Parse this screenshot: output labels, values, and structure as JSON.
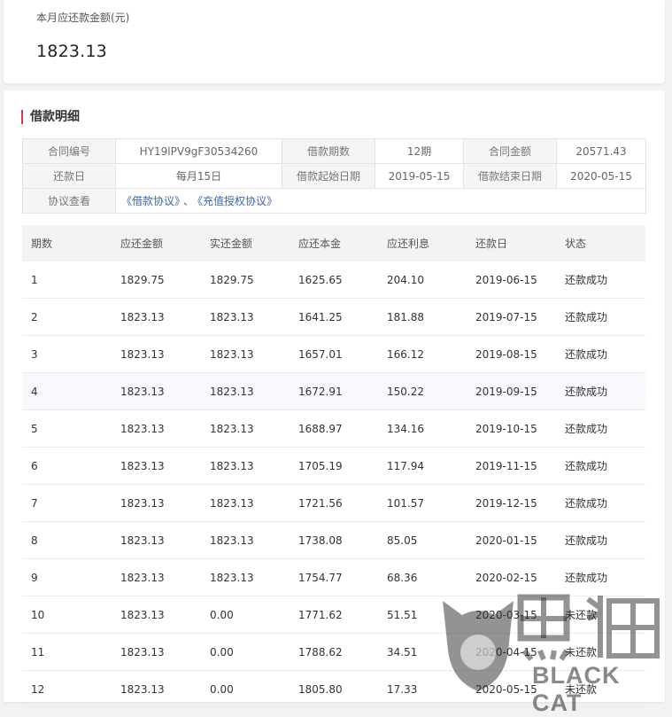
{
  "summary": {
    "label": "本月应还款金额(元)",
    "amount": "1823.13"
  },
  "detail": {
    "title": "借款明细",
    "contract_no_label": "合同编号",
    "contract_no": "HY19lPV9gF30534260",
    "term_label": "借款期数",
    "term": "12期",
    "amount_label": "合同金额",
    "amount": "20571.43",
    "due_day_label": "还款日",
    "due_day": "每月15日",
    "start_label": "借款起始日期",
    "start": "2019-05-15",
    "end_label": "借款结束日期",
    "end": "2020-05-15",
    "agreement_label": "协议查看",
    "agreement_link1": "《借款协议》",
    "agreement_sep": "、",
    "agreement_link2": "《充值授权协议》"
  },
  "schedule": {
    "headers": [
      "期数",
      "应还金额",
      "实还金额",
      "应还本金",
      "应还利息",
      "还款日",
      "状态"
    ],
    "rows": [
      [
        "1",
        "1829.75",
        "1829.75",
        "1625.65",
        "204.10",
        "2019-06-15",
        "还款成功"
      ],
      [
        "2",
        "1823.13",
        "1823.13",
        "1641.25",
        "181.88",
        "2019-07-15",
        "还款成功"
      ],
      [
        "3",
        "1823.13",
        "1823.13",
        "1657.01",
        "166.12",
        "2019-08-15",
        "还款成功"
      ],
      [
        "4",
        "1823.13",
        "1823.13",
        "1672.91",
        "150.22",
        "2019-09-15",
        "还款成功"
      ],
      [
        "5",
        "1823.13",
        "1823.13",
        "1688.97",
        "134.16",
        "2019-10-15",
        "还款成功"
      ],
      [
        "6",
        "1823.13",
        "1823.13",
        "1705.19",
        "117.94",
        "2019-11-15",
        "还款成功"
      ],
      [
        "7",
        "1823.13",
        "1823.13",
        "1721.56",
        "101.57",
        "2019-12-15",
        "还款成功"
      ],
      [
        "8",
        "1823.13",
        "1823.13",
        "1738.08",
        "85.05",
        "2020-01-15",
        "还款成功"
      ],
      [
        "9",
        "1823.13",
        "1823.13",
        "1754.77",
        "68.36",
        "2020-02-15",
        "还款成功"
      ],
      [
        "10",
        "1823.13",
        "0.00",
        "1771.62",
        "51.51",
        "2020-03-15",
        "未还款"
      ],
      [
        "11",
        "1823.13",
        "0.00",
        "1788.62",
        "34.51",
        "2020-04-15",
        "未还款"
      ],
      [
        "12",
        "1823.13",
        "0.00",
        "1805.80",
        "17.33",
        "2020-05-15",
        "未还款"
      ]
    ]
  },
  "watermark": {
    "text": "BLACK CAT",
    "logo_chars": "黑猫"
  }
}
